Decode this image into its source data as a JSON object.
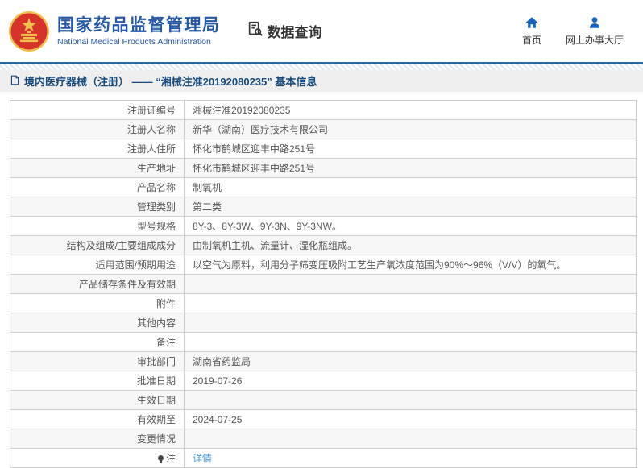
{
  "header": {
    "logo": {
      "emblem_icon": "national-emblem-icon",
      "title_cn": "国家药品监督管理局",
      "title_en": "National Medical Products Administration"
    },
    "section": {
      "icon": "doc-search-icon",
      "label": "数据查询"
    },
    "nav": [
      {
        "icon": "home-icon",
        "label": "首页"
      },
      {
        "icon": "user-icon",
        "label": "网上办事大厅"
      }
    ]
  },
  "page": {
    "title_icon": "document-icon",
    "title": "境内医疗器械（注册） —— “湘械注准20192080235” 基本信息"
  },
  "table": {
    "rows": [
      {
        "label": "注册证编号",
        "value": "湘械注准20192080235"
      },
      {
        "label": "注册人名称",
        "value": "新华（湖南）医疗技术有限公司"
      },
      {
        "label": "注册人住所",
        "value": "怀化市鹤城区迎丰中路251号"
      },
      {
        "label": "生产地址",
        "value": "怀化市鹤城区迎丰中路251号"
      },
      {
        "label": "产品名称",
        "value": "制氧机"
      },
      {
        "label": "管理类别",
        "value": "第二类"
      },
      {
        "label": "型号规格",
        "value": "8Y-3、8Y-3W、9Y-3N、9Y-3NW。"
      },
      {
        "label": "结构及组成/主要组成成分",
        "value": "由制氧机主机、流量计、湿化瓶组成。"
      },
      {
        "label": "适用范围/预期用途",
        "value": "以空气为原料，利用分子筛变压吸附工艺生产氧浓度范围为90%～96%（V/V）的氧气。"
      },
      {
        "label": "产品储存条件及有效期",
        "value": ""
      },
      {
        "label": "附件",
        "value": ""
      },
      {
        "label": "其他内容",
        "value": ""
      },
      {
        "label": "备注",
        "value": ""
      },
      {
        "label": "审批部门",
        "value": "湖南省药监局"
      },
      {
        "label": "批准日期",
        "value": "2019-07-26"
      },
      {
        "label": "生效日期",
        "value": ""
      },
      {
        "label": "有效期至",
        "value": "2024-07-25"
      },
      {
        "label": "变更情况",
        "value": ""
      },
      {
        "label": "注",
        "value": "详情",
        "link": true,
        "icon": "bulb-icon"
      }
    ]
  },
  "colors": {
    "accent_blue": "#1c6ea4",
    "logo_blue": "#2558a7",
    "title_text": "#17497b",
    "link_blue": "#4a9ede",
    "table_border": "#cccccc",
    "row_alt_bg": "#f7f7f7",
    "title_bar_bg": "#efefef",
    "nav_icon_blue": "#1565c0",
    "emblem_red": "#d6342b",
    "emblem_gold": "#f0c14b"
  }
}
